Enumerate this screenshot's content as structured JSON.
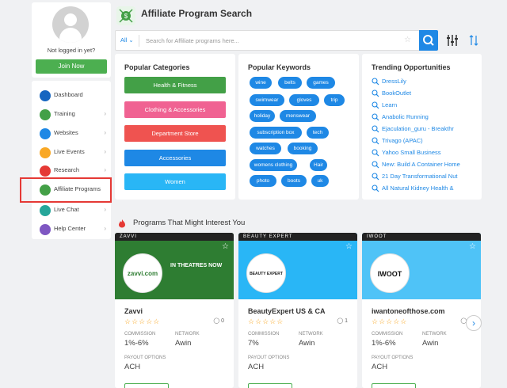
{
  "sidebar": {
    "login_status": "Not logged in yet?",
    "join_label": "Join Now",
    "items": [
      {
        "label": "Dashboard",
        "icon": "home-icon",
        "color": "#1565c0",
        "has_chevron": false
      },
      {
        "label": "Training",
        "icon": "play-icon",
        "color": "#43a047",
        "has_chevron": true
      },
      {
        "label": "Websites",
        "icon": "websites-icon",
        "color": "#1e88e5",
        "has_chevron": true
      },
      {
        "label": "Live Events",
        "icon": "live-events-icon",
        "color": "#f9a825",
        "has_chevron": true
      },
      {
        "label": "Research",
        "icon": "research-icon",
        "color": "#e53935",
        "has_chevron": true
      },
      {
        "label": "Affiliate Programs",
        "icon": "affiliate-programs-icon",
        "color": "#43a047",
        "has_chevron": false
      },
      {
        "label": "Live Chat",
        "icon": "chat-icon",
        "color": "#26a69a",
        "has_chevron": true
      },
      {
        "label": "Help Center",
        "icon": "help-icon",
        "color": "#7e57c2",
        "has_chevron": true
      }
    ]
  },
  "header": {
    "title": "Affiliate Program Search"
  },
  "search": {
    "category": "All",
    "placeholder": "Search for Affiliate programs here..."
  },
  "popular_categories": {
    "title": "Popular Categories",
    "items": [
      {
        "label": "Health & Fitness",
        "color": "#43a047"
      },
      {
        "label": "Clothing & Accessories",
        "color": "#f06292"
      },
      {
        "label": "Department Store",
        "color": "#ef5350"
      },
      {
        "label": "Accessories",
        "color": "#1e88e5"
      },
      {
        "label": "Women",
        "color": "#29b6f6"
      }
    ]
  },
  "popular_keywords": {
    "title": "Popular Keywords",
    "items": [
      "wine",
      "belts",
      "games",
      "swimwear",
      "gloves",
      "trip",
      "holiday",
      "menswear",
      "subscription box",
      "tech",
      "watches",
      "booking",
      "womens clothing",
      "Hair",
      "photo",
      "boots",
      "uk"
    ]
  },
  "trending": {
    "title": "Trending Opportunities",
    "items": [
      "DressLily",
      "BookOutlet",
      "Learn",
      "Anabolic Running",
      "Ejaculation_guru - Breakthr",
      "Trivago (APAC)",
      "Yahoo Small Business",
      "New: Build A Container Home",
      "21 Day Transformational Nut",
      "All Natural Kidney Health &"
    ]
  },
  "programs": {
    "title": "Programs That Might Interest You",
    "commission_label": "COMMISSION",
    "network_label": "NETWORK",
    "payout_label": "PAYOUT OPTIONS",
    "cards": [
      {
        "name": "Zavvi",
        "logo": "zavvi.com",
        "comments": "0",
        "commission": "1%-6%",
        "network": "Awin",
        "payout": "ACH",
        "banner_color": "#2e7d32",
        "header_text": "ZAVVI",
        "banner_text": "IN THEATRES NOW"
      },
      {
        "name": "BeautyExpert US & CA",
        "logo": "BEAUTY EXPERT",
        "comments": "1",
        "commission": "7%",
        "network": "Awin",
        "payout": "ACH",
        "banner_color": "#29b6f6",
        "header_text": "BEAUTY EXPERT",
        "banner_text": ""
      },
      {
        "name": "iwantoneofthose.com",
        "logo": "IWOOT",
        "comments": "0",
        "commission": "1%-6%",
        "network": "Awin",
        "payout": "ACH",
        "banner_color": "#4fc3f7",
        "header_text": "IWOOT",
        "banner_text": ""
      }
    ]
  },
  "colors": {
    "accent": "#1e88e5",
    "success": "#4caf50",
    "highlight": "#e53935"
  }
}
